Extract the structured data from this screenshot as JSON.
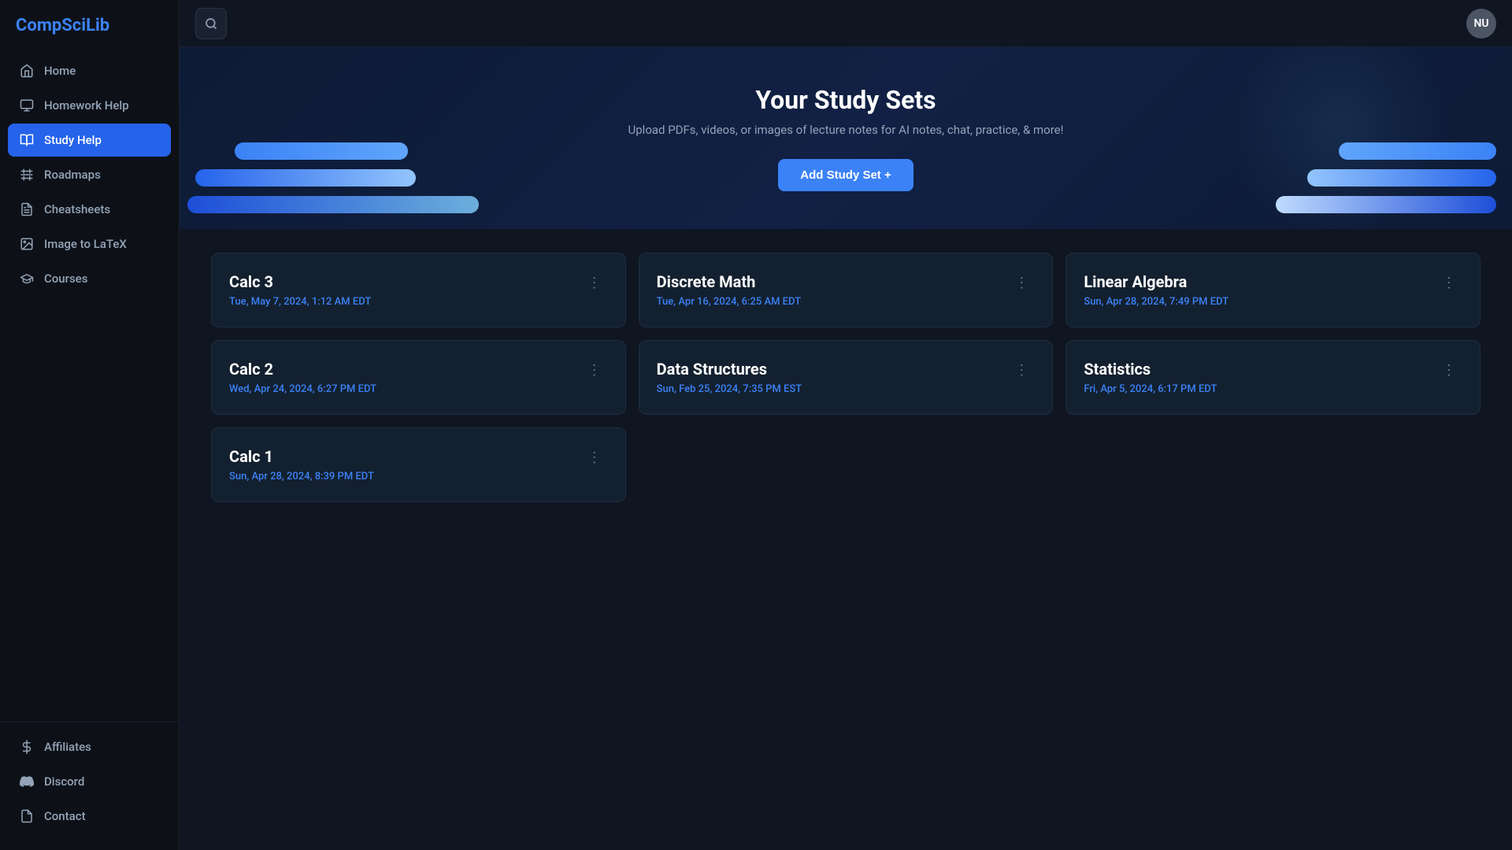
{
  "app": {
    "logo_text1": "CompSci",
    "logo_text2": "Lib",
    "user_initials": "NU"
  },
  "sidebar": {
    "nav_items": [
      {
        "id": "home",
        "label": "Home",
        "icon": "home"
      },
      {
        "id": "homework-help",
        "label": "Homework Help",
        "icon": "homework"
      },
      {
        "id": "study-help",
        "label": "Study Help",
        "icon": "study",
        "active": true
      },
      {
        "id": "roadmaps",
        "label": "Roadmaps",
        "icon": "roadmaps"
      },
      {
        "id": "cheatsheets",
        "label": "Cheatsheets",
        "icon": "cheatsheets"
      },
      {
        "id": "image-to-latex",
        "label": "Image to LaTeX",
        "icon": "image"
      },
      {
        "id": "courses",
        "label": "Courses",
        "icon": "courses"
      }
    ],
    "bottom_items": [
      {
        "id": "affiliates",
        "label": "Affiliates",
        "icon": "dollar"
      },
      {
        "id": "discord",
        "label": "Discord",
        "icon": "discord"
      },
      {
        "id": "contact",
        "label": "Contact",
        "icon": "contact"
      }
    ]
  },
  "hero": {
    "title": "Your Study Sets",
    "subtitle": "Upload PDFs, videos, or images of lecture notes for AI notes, chat, practice, & more!",
    "add_button": "Add Study Set +"
  },
  "study_sets": [
    {
      "id": "calc3",
      "title": "Calc 3",
      "date": "Tue, May 7, 2024, 1:12 AM EDT"
    },
    {
      "id": "discrete-math",
      "title": "Discrete Math",
      "date": "Tue, Apr 16, 2024, 6:25 AM EDT"
    },
    {
      "id": "linear-algebra",
      "title": "Linear Algebra",
      "date": "Sun, Apr 28, 2024, 7:49 PM EDT"
    },
    {
      "id": "calc2",
      "title": "Calc 2",
      "date": "Wed, Apr 24, 2024, 6:27 PM EDT"
    },
    {
      "id": "data-structures",
      "title": "Data Structures",
      "date": "Sun, Feb 25, 2024, 7:35 PM EST"
    },
    {
      "id": "statistics",
      "title": "Statistics",
      "date": "Fri, Apr 5, 2024, 6:17 PM EDT"
    },
    {
      "id": "calc1",
      "title": "Calc 1",
      "date": "Sun, Apr 28, 2024, 8:39 PM EDT"
    }
  ]
}
